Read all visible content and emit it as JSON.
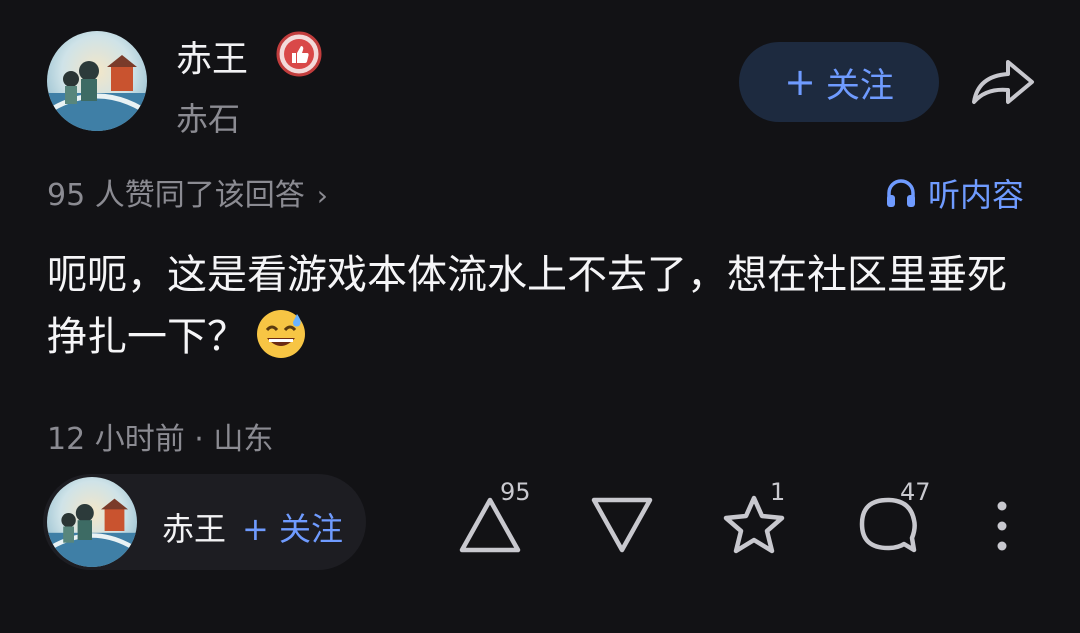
{
  "author": {
    "name": "赤王",
    "subtitle": "赤石"
  },
  "follow_button": {
    "plus": "+",
    "label": "关注"
  },
  "agree": {
    "text": "95 人赞同了该回答",
    "chevron": "›"
  },
  "listen": {
    "label": "听内容",
    "icon": "headphones-icon"
  },
  "answer": {
    "text": "呃呃，这是看游戏本体流水上不去了，想在社区里垂死挣扎一下？",
    "emoji": "grinning-sweat-emoji"
  },
  "meta": {
    "text": "12 小时前 · 山东"
  },
  "bottom_bar": {
    "author_name": "赤王",
    "follow_label": "+ 关注",
    "upvote_count": "95",
    "star_count": "1",
    "comment_count": "47"
  },
  "colors": {
    "background": "#121215",
    "accent": "#6f9bff",
    "muted": "#8b8b92",
    "pill": "#1d1d22",
    "follow_bg": "#1d2a3f"
  }
}
